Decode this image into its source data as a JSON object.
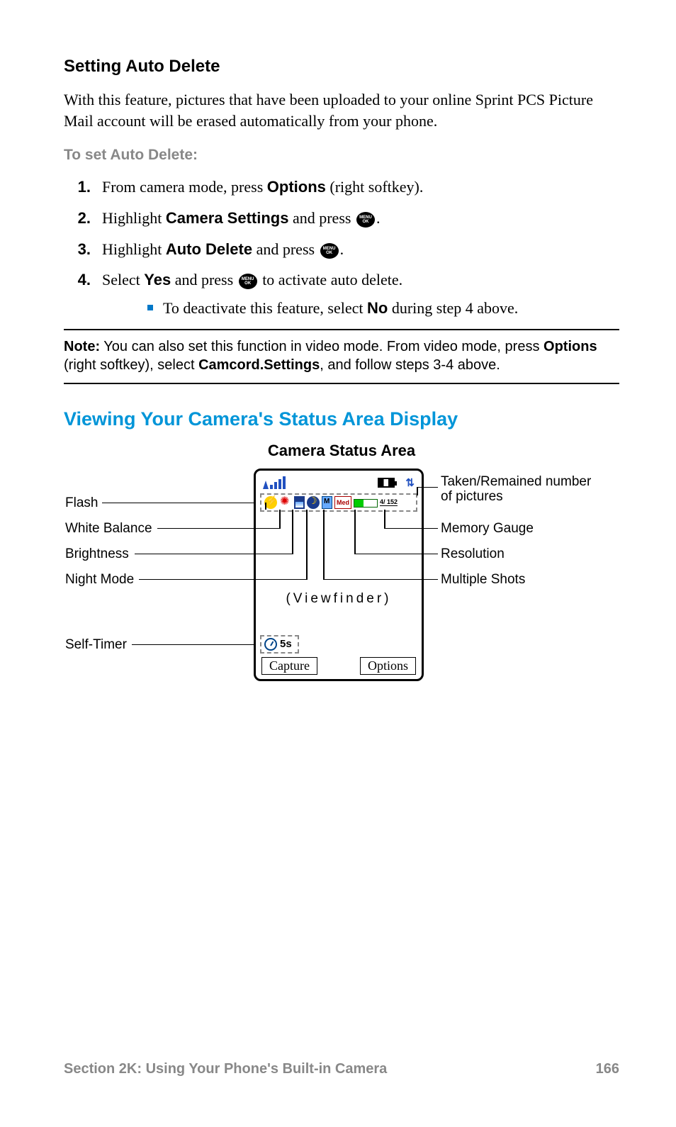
{
  "heading1": "Setting Auto Delete",
  "intro": "With this feature, pictures that have been uploaded to your online Sprint PCS Picture Mail account will be erased automatically from your phone.",
  "subhead": "To set Auto Delete:",
  "steps": {
    "n1": "1.",
    "s1a": "From camera mode, press ",
    "s1b": "Options",
    "s1c": " (right softkey).",
    "n2": "2.",
    "s2a": "Highlight ",
    "s2b": "Camera Settings",
    "s2c": " and press ",
    "s2d": ".",
    "n3": "3.",
    "s3a": "Highlight ",
    "s3b": "Auto Delete",
    "s3c": " and press ",
    "s3d": ".",
    "n4": "4.",
    "s4a": "Select ",
    "s4b": "Yes",
    "s4c": " and press ",
    "s4d": " to activate auto delete.",
    "sub_a": "To deactivate this feature, select ",
    "sub_b": "No",
    "sub_c": " during step 4 above."
  },
  "note": {
    "label": "Note:",
    "t1": " You can also set this function in video mode. From video mode, press ",
    "t2": "Options",
    "t3": " (right softkey), select ",
    "t4": "Camcord.Settings",
    "t5": ", and follow steps 3-4 above."
  },
  "heading2": "Viewing Your Camera's Status Area Display",
  "diagram_title": "Camera Status Area",
  "diagram": {
    "count": "4/ 152",
    "res": "Med",
    "viewfinder": "(Viewfinder)",
    "timer": "5s",
    "capture": "Capture",
    "options": "Options",
    "labels": {
      "flash": "Flash",
      "wb": "White Balance",
      "bright": "Brightness",
      "night": "Night Mode",
      "selftimer": "Self-Timer",
      "taken": "Taken/Remained number of pictures",
      "gauge": "Memory Gauge",
      "resolution": "Resolution",
      "multi": "Multiple Shots"
    }
  },
  "footer_section": "Section 2K: Using Your Phone's Built-in Camera",
  "footer_page": "166"
}
